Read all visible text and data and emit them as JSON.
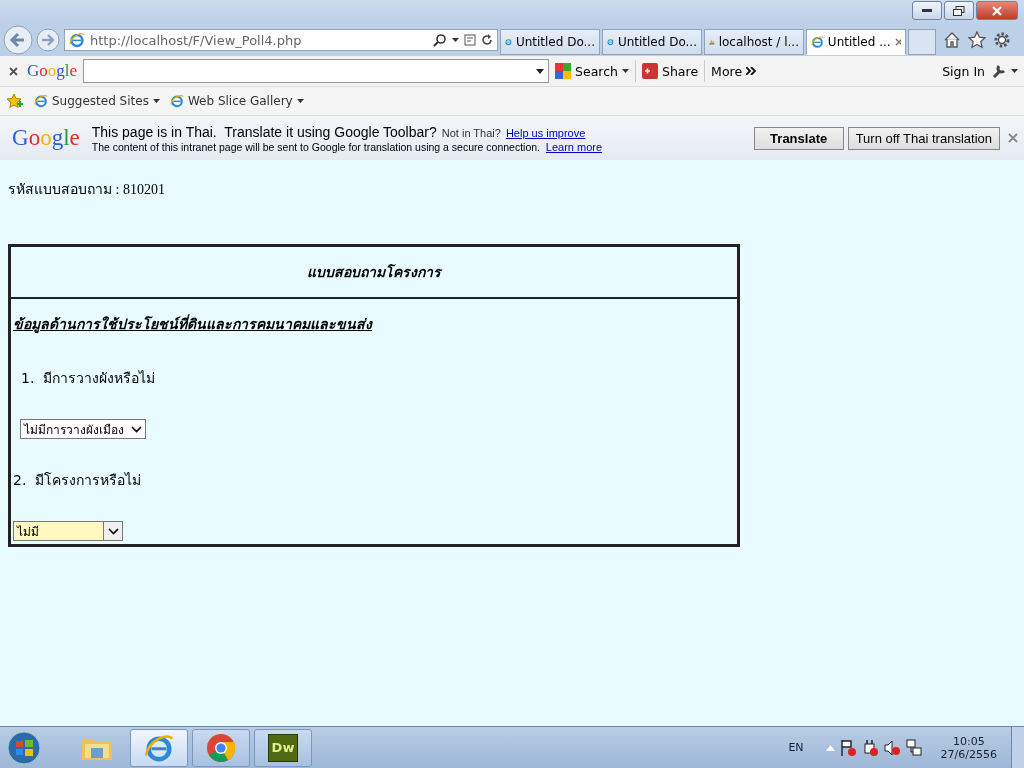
{
  "browser": {
    "address": "http://localhost/F/View_Poll4.php",
    "tabs": [
      {
        "label": "Untitled Do...",
        "kind": "ie",
        "selected": false
      },
      {
        "label": "Untitled Do...",
        "kind": "ie",
        "selected": false
      },
      {
        "label": "localhost / l...",
        "kind": "pma",
        "selected": false
      },
      {
        "label": "Untitled ...",
        "kind": "ie",
        "selected": true
      }
    ]
  },
  "google_toolbar": {
    "logo": "Google",
    "search": "Search",
    "share": "Share",
    "more": "More",
    "sign_in": "Sign In"
  },
  "favorites": [
    {
      "label": "Suggested Sites"
    },
    {
      "label": "Web Slice Gallery"
    }
  ],
  "translate_bar": {
    "logo": "Google",
    "message": "This page is in Thai.  Translate it using Google Toolbar?",
    "not_in": "Not in Thai?",
    "help_link": "Help us improve",
    "notice": "The content of this intranet page will be sent to Google for translation using a secure connection.",
    "learn_more": "Learn more",
    "translate_button": "Translate",
    "turn_off_button": "Turn off Thai translation"
  },
  "page": {
    "code_line": "รหัสแบบสอบถาม : 810201",
    "form": {
      "title": "แบบสอบถามโครงการ",
      "section": "ข้อมูลด้านการใช้ประโยชน์ที่ดินและการคมนาคมและขนส่ง",
      "questions": [
        {
          "number": "1.",
          "text": "มีการวางผังหรือไม่",
          "answer": "ไม่มีการวางผังเมือง",
          "highlighted": false
        },
        {
          "number": "2.",
          "text": "มีโครงการหรือไม่",
          "answer": "ไม่มี",
          "highlighted": true
        }
      ]
    }
  },
  "taskbar": {
    "apps": [
      {
        "kind": "folder",
        "selected": false
      },
      {
        "kind": "ie",
        "selected": true
      },
      {
        "kind": "chrome",
        "selected": false
      },
      {
        "kind": "dreamweaver",
        "label": "Dw",
        "selected": false
      }
    ],
    "language": "EN",
    "time": "10:05",
    "date": "27/6/2556"
  }
}
